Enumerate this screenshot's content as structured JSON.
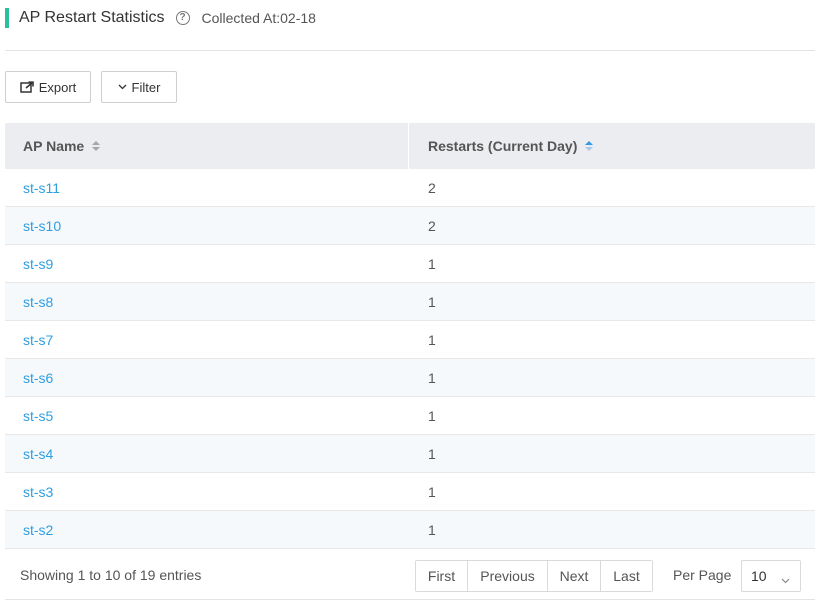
{
  "header": {
    "title": "AP Restart Statistics",
    "help_icon": "?",
    "collected": "Collected At:02-18"
  },
  "toolbar": {
    "export_label": "Export",
    "filter_label": "Filter",
    "export_icon": "export-icon",
    "filter_icon": "chevron-down-icon"
  },
  "table": {
    "columns": [
      "AP Name",
      "Restarts (Current Day)"
    ],
    "rows": [
      {
        "name": "st-s11",
        "restarts": "2"
      },
      {
        "name": "st-s10",
        "restarts": "2"
      },
      {
        "name": "st-s9",
        "restarts": "1"
      },
      {
        "name": "st-s8",
        "restarts": "1"
      },
      {
        "name": "st-s7",
        "restarts": "1"
      },
      {
        "name": "st-s6",
        "restarts": "1"
      },
      {
        "name": "st-s5",
        "restarts": "1"
      },
      {
        "name": "st-s4",
        "restarts": "1"
      },
      {
        "name": "st-s3",
        "restarts": "1"
      },
      {
        "name": "st-s2",
        "restarts": "1"
      }
    ]
  },
  "footer": {
    "showing": "Showing 1 to 10 of 19 entries",
    "first": "First",
    "previous": "Previous",
    "next": "Next",
    "last": "Last",
    "per_page_label": "Per Page",
    "per_page_value": "10"
  },
  "colors": {
    "accent": "#2bbf9a",
    "link": "#2d9fe0",
    "sort_active": "#3399e6"
  }
}
